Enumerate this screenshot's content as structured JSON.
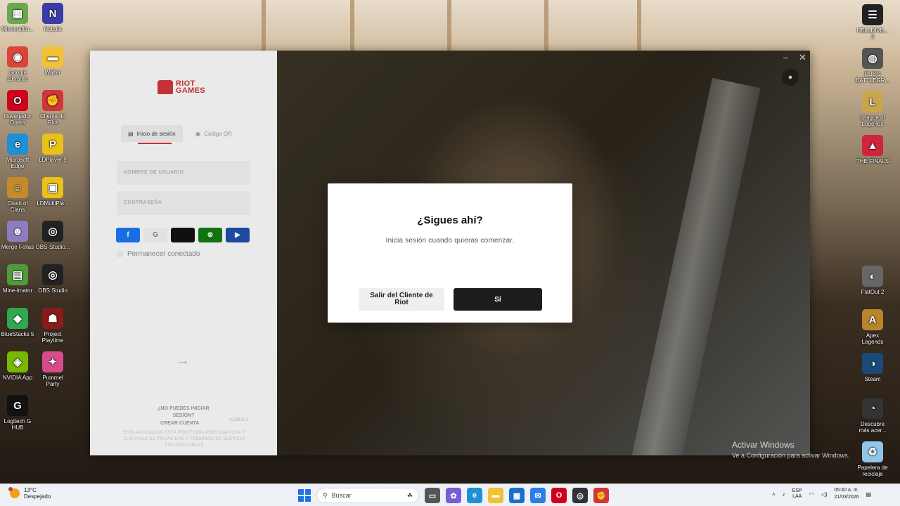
{
  "desktop": {
    "left_icons": [
      {
        "label": "Minecraftln...",
        "icon": "minecraft-icon",
        "color": "#6aa84f",
        "glyph": "▦"
      },
      {
        "label": "Nebula",
        "icon": "nebula-icon",
        "color": "#3a3aa8",
        "glyph": "N"
      },
      {
        "label": "Google Chrome",
        "icon": "chrome-icon",
        "color": "#db4437",
        "glyph": "◉"
      },
      {
        "label": "Walter",
        "icon": "folder-icon",
        "color": "#f1c232",
        "glyph": "▬"
      },
      {
        "label": "Navegador Opera",
        "icon": "opera-icon",
        "color": "#d0021b",
        "glyph": "O"
      },
      {
        "label": "Cliente de Riot",
        "icon": "riot-client-icon",
        "color": "#d13639",
        "glyph": "✊"
      },
      {
        "label": "Microsoft Edge",
        "icon": "edge-icon",
        "color": "#1f8fd6",
        "glyph": "e"
      },
      {
        "label": "LDPlayer 9",
        "icon": "ldplayer-icon",
        "color": "#e8c21a",
        "glyph": "P"
      },
      {
        "label": "Clash of Clans",
        "icon": "clash-of-clans-icon",
        "color": "#c58b2a",
        "glyph": "☺"
      },
      {
        "label": "LDMultiPla...",
        "icon": "ldmultiplayer-icon",
        "color": "#e8c21a",
        "glyph": "▣"
      },
      {
        "label": "Merge Fellas",
        "icon": "merge-fellas-icon",
        "color": "#8e7cc3",
        "glyph": "☻"
      },
      {
        "label": "OBS-Studio...",
        "icon": "obs-icon",
        "color": "#222222",
        "glyph": "◎"
      },
      {
        "label": "Mine-imator",
        "icon": "mine-imator-icon",
        "color": "#4f9a3a",
        "glyph": "▤"
      },
      {
        "label": "OBS Studio",
        "icon": "obs-icon",
        "color": "#222222",
        "glyph": "◎"
      },
      {
        "label": "BlueStacks 5",
        "icon": "bluestacks-icon",
        "color": "#2fa84f",
        "glyph": "◆"
      },
      {
        "label": "Project Playtime",
        "icon": "project-playtime-icon",
        "color": "#8b1a1a",
        "glyph": "☗"
      },
      {
        "label": "NVIDIA App",
        "icon": "nvidia-icon",
        "color": "#76b900",
        "glyph": "◈"
      },
      {
        "label": "Pummel Party",
        "icon": "pummel-party-icon",
        "color": "#d94b8a",
        "glyph": "✦"
      },
      {
        "label": "Logitech G HUB",
        "icon": "logitech-icon",
        "color": "#111111",
        "glyph": "G"
      }
    ],
    "right_icons": [
      {
        "label": "HELLDIVE... 2",
        "icon": "helldivers-icon",
        "color": "#222222",
        "glyph": "☰"
      },
      {
        "label": "PUBG BATTLEGR...",
        "icon": "pubg-icon",
        "color": "#555555",
        "glyph": "◍"
      },
      {
        "label": "League of Legends",
        "icon": "league-icon",
        "color": "#c8a64b",
        "glyph": "L"
      },
      {
        "label": "THE FINALS",
        "icon": "the-finals-icon",
        "color": "#d0243c",
        "glyph": "▲"
      },
      {
        "label": "FlatOut 2",
        "icon": "flatout-icon",
        "color": "#666666",
        "glyph": "◐"
      },
      {
        "label": "Apex Legends",
        "icon": "apex-icon",
        "color": "#b8852b",
        "glyph": "A"
      },
      {
        "label": "Steam",
        "icon": "steam-icon",
        "color": "#1b4a7a",
        "glyph": "◑"
      },
      {
        "label": "Descubre más acer...",
        "icon": "discover-icon",
        "color": "#333333",
        "glyph": "◔"
      },
      {
        "label": "Papelera de reciclaje",
        "icon": "recycle-bin-icon",
        "color": "#8ec5e8",
        "glyph": "♻"
      }
    ]
  },
  "riot_window": {
    "logo_line1": "RIOT",
    "logo_line2": "GAMES",
    "tabs": {
      "signin": "Inicio de sesión",
      "qr": "Código QR"
    },
    "username_label": "NOMBRE DE USUARIO",
    "password_label": "CONTRASEÑA",
    "social": [
      {
        "name": "facebook-button",
        "glyph": "f",
        "color": "#1877f2"
      },
      {
        "name": "google-button",
        "glyph": "G",
        "color": "#f1f1f1"
      },
      {
        "name": "apple-button",
        "glyph": "",
        "color": "#111111"
      },
      {
        "name": "xbox-button",
        "glyph": "⊗",
        "color": "#107c10"
      },
      {
        "name": "playstation-button",
        "glyph": "▶",
        "color": "#1f4fa8"
      }
    ],
    "remember": "Permanecer conectado",
    "cant_login": "¿NO PUEDES INICIAR SESIÓN?",
    "create_account": "CREAR CUENTA",
    "version": "v128.0.1",
    "captcha": "ESTA APLICACIÓN ESTÁ PROTEGIDA POR hCAPTCHA Y SUS AVISO DE PRIVACIDAD Y TÉRMINOS DE SERVICIO SON APLICABLES"
  },
  "dialog": {
    "title": "¿Sigues ahí?",
    "subtitle": "Inicia sesión cuando quieras comenzar.",
    "exit_button": "Salir del Cliente de Riot",
    "yes_button": "Sí"
  },
  "watermark": {
    "line1": "Activar Windows",
    "line2": "Ve a Configuración para activar Windows."
  },
  "taskbar": {
    "weather_temp": "13°C",
    "weather_desc": "Despejado",
    "search_placeholder": "Buscar",
    "lang1": "ESP",
    "lang2": "LAA",
    "time": "05:40 a. m.",
    "date": "21/03/2026"
  }
}
